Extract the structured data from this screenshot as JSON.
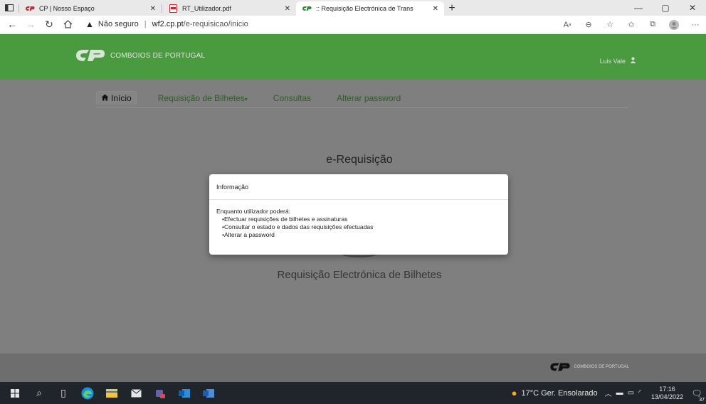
{
  "tabs": [
    {
      "title": "CP | Nosso Espaço",
      "icon": "cp-logo-icon"
    },
    {
      "title": "RT_Utilizador.pdf",
      "icon": "pdf-icon"
    },
    {
      "title": ":: Requisição Electrónica de Trans",
      "icon": "cp-logo-icon"
    }
  ],
  "address": {
    "security": "Não seguro",
    "host": "wf2.cp.pt",
    "path": "/e-requisicao/inicio"
  },
  "site": {
    "brand": "COMBOIOS DE PORTUGAL",
    "user": "Luis Vale",
    "brand_color": "#4a9a3f"
  },
  "menu": {
    "items": [
      "Início",
      "Requisição de Bilhetes",
      "Consultas",
      "Alterar password"
    ],
    "dropdown_caret": "▾"
  },
  "main": {
    "title": "e-Requisição",
    "subtitle": "Requisição Electrónica de Bilhetes"
  },
  "modal": {
    "title": "Informação",
    "intro": "Enquanto utilizador poderá:",
    "items": [
      "Efectuar requisições de bilhetes e assinaturas",
      "Consultar o estado e dados das requisições efectuadas",
      "Alterar a password"
    ]
  },
  "footer": {
    "brand": "COMBOIOS DE PORTUGAL"
  },
  "taskbar": {
    "weather": "17°C  Ger. Ensolarado",
    "time": "17:16",
    "date": "13/04/2022",
    "notifications": "37"
  }
}
